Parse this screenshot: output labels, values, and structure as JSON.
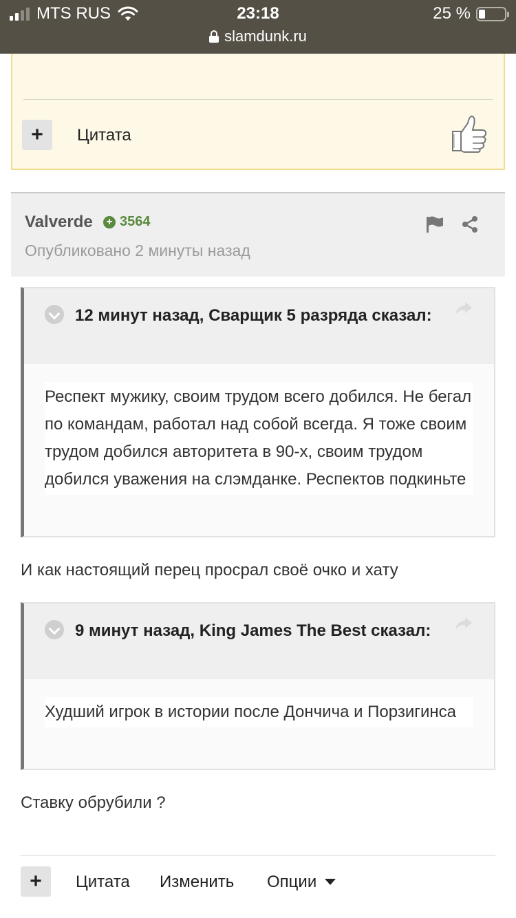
{
  "status_bar": {
    "carrier": "MTS RUS",
    "time": "23:18",
    "battery_percent": "25 %",
    "battery_level": 0.25,
    "url": "slamdunk.ru"
  },
  "previous_post": {
    "quote_label": "Цитата"
  },
  "post": {
    "author": "Valverde",
    "reputation": "3564",
    "published": "Опубликовано 2 минуты назад",
    "quotes": [
      {
        "header": "12 минут назад, Сварщик 5 разряда сказал:",
        "text": "Респект мужику, своим трудом всего добился. Не бегал по командам, работал над собой всегда. Я тоже своим трудом добился авторитета в 90-х, своим трудом добился уважения на слэмданке. Респектов подкиньте"
      },
      {
        "header": "9 минут назад, King James The Best сказал:",
        "text": "Худший игрок в истории после Дончича и Порзигинса"
      }
    ],
    "replies": [
      "И как настоящий перец просрал своё очко и хату",
      "Ставку обрубили ?"
    ]
  },
  "actions": {
    "plus": "+",
    "quote": "Цитата",
    "edit": "Изменить",
    "options": "Опции"
  },
  "colors": {
    "status_bar": "#545045",
    "reputation": "#598a3d",
    "quote_border": "#777777"
  }
}
